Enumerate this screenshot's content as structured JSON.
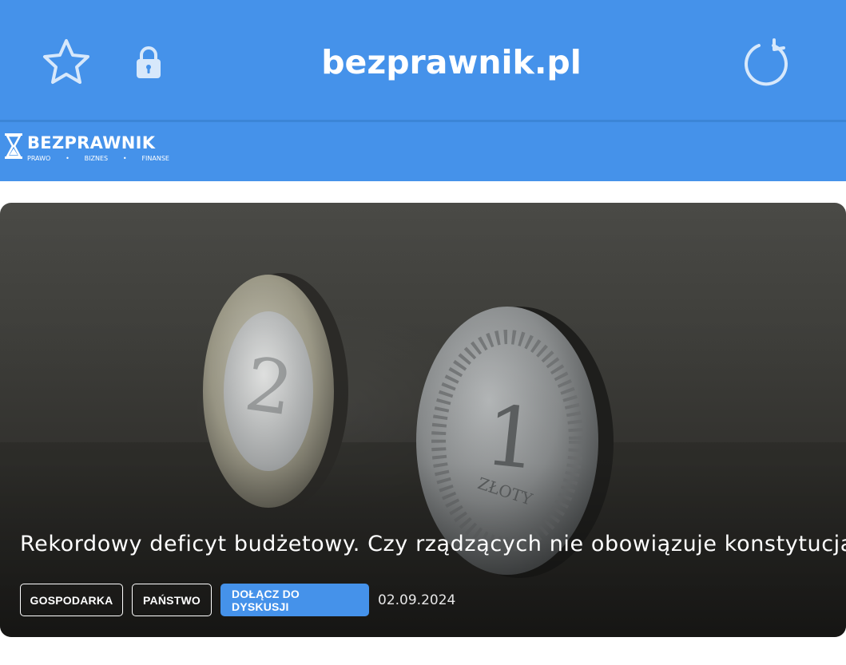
{
  "browser": {
    "url": "bezprawnik.pl",
    "bar_color": "#4592ea",
    "icons": {
      "bookmark": "star-icon",
      "security": "lock-icon",
      "reload": "reload-icon"
    }
  },
  "site_header": {
    "logo": {
      "name": "BEZPRAWNIK",
      "tagline": [
        "PRAWO",
        "BIZNES",
        "FINANSE"
      ],
      "separator": "•"
    },
    "background": "#4592ea"
  },
  "hero": {
    "title": "Rekordowy deficyt budżetowy. Czy rządzących nie obowiązuje konstytucja?",
    "tags": [
      "GOSPODARKA",
      "PAŃSTWO"
    ],
    "cta": "DOŁĄCZ DO DYSKUSJI",
    "date": "02.09.2024",
    "accent": "#4592ea"
  }
}
